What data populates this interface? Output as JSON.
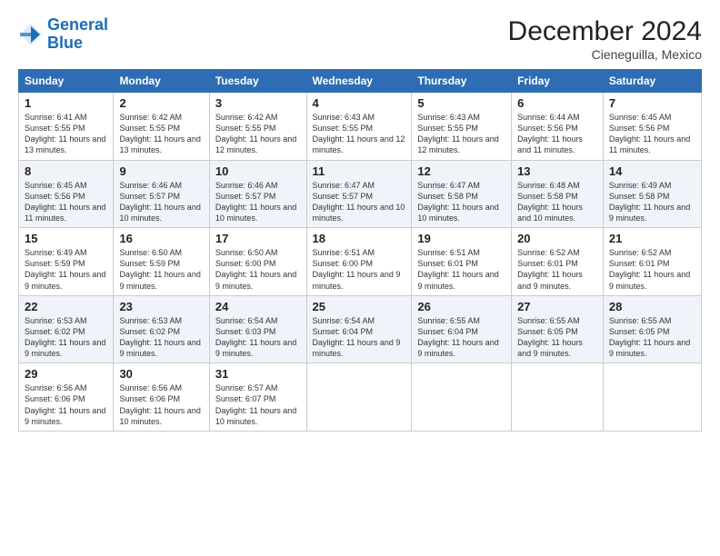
{
  "header": {
    "logo_line1": "General",
    "logo_line2": "Blue",
    "month": "December 2024",
    "location": "Cieneguilla, Mexico"
  },
  "weekdays": [
    "Sunday",
    "Monday",
    "Tuesday",
    "Wednesday",
    "Thursday",
    "Friday",
    "Saturday"
  ],
  "weeks": [
    [
      {
        "day": "1",
        "rise": "6:41 AM",
        "set": "5:55 PM",
        "hours": "11 hours and 13 minutes."
      },
      {
        "day": "2",
        "rise": "6:42 AM",
        "set": "5:55 PM",
        "hours": "11 hours and 13 minutes."
      },
      {
        "day": "3",
        "rise": "6:42 AM",
        "set": "5:55 PM",
        "hours": "11 hours and 12 minutes."
      },
      {
        "day": "4",
        "rise": "6:43 AM",
        "set": "5:55 PM",
        "hours": "11 hours and 12 minutes."
      },
      {
        "day": "5",
        "rise": "6:43 AM",
        "set": "5:55 PM",
        "hours": "11 hours and 12 minutes."
      },
      {
        "day": "6",
        "rise": "6:44 AM",
        "set": "5:56 PM",
        "hours": "11 hours and 11 minutes."
      },
      {
        "day": "7",
        "rise": "6:45 AM",
        "set": "5:56 PM",
        "hours": "11 hours and 11 minutes."
      }
    ],
    [
      {
        "day": "8",
        "rise": "6:45 AM",
        "set": "5:56 PM",
        "hours": "11 hours and 11 minutes."
      },
      {
        "day": "9",
        "rise": "6:46 AM",
        "set": "5:57 PM",
        "hours": "11 hours and 10 minutes."
      },
      {
        "day": "10",
        "rise": "6:46 AM",
        "set": "5:57 PM",
        "hours": "11 hours and 10 minutes."
      },
      {
        "day": "11",
        "rise": "6:47 AM",
        "set": "5:57 PM",
        "hours": "11 hours and 10 minutes."
      },
      {
        "day": "12",
        "rise": "6:47 AM",
        "set": "5:58 PM",
        "hours": "11 hours and 10 minutes."
      },
      {
        "day": "13",
        "rise": "6:48 AM",
        "set": "5:58 PM",
        "hours": "11 hours and 10 minutes."
      },
      {
        "day": "14",
        "rise": "6:49 AM",
        "set": "5:58 PM",
        "hours": "11 hours and 9 minutes."
      }
    ],
    [
      {
        "day": "15",
        "rise": "6:49 AM",
        "set": "5:59 PM",
        "hours": "11 hours and 9 minutes."
      },
      {
        "day": "16",
        "rise": "6:50 AM",
        "set": "5:59 PM",
        "hours": "11 hours and 9 minutes."
      },
      {
        "day": "17",
        "rise": "6:50 AM",
        "set": "6:00 PM",
        "hours": "11 hours and 9 minutes."
      },
      {
        "day": "18",
        "rise": "6:51 AM",
        "set": "6:00 PM",
        "hours": "11 hours and 9 minutes."
      },
      {
        "day": "19",
        "rise": "6:51 AM",
        "set": "6:01 PM",
        "hours": "11 hours and 9 minutes."
      },
      {
        "day": "20",
        "rise": "6:52 AM",
        "set": "6:01 PM",
        "hours": "11 hours and 9 minutes."
      },
      {
        "day": "21",
        "rise": "6:52 AM",
        "set": "6:01 PM",
        "hours": "11 hours and 9 minutes."
      }
    ],
    [
      {
        "day": "22",
        "rise": "6:53 AM",
        "set": "6:02 PM",
        "hours": "11 hours and 9 minutes."
      },
      {
        "day": "23",
        "rise": "6:53 AM",
        "set": "6:02 PM",
        "hours": "11 hours and 9 minutes."
      },
      {
        "day": "24",
        "rise": "6:54 AM",
        "set": "6:03 PM",
        "hours": "11 hours and 9 minutes."
      },
      {
        "day": "25",
        "rise": "6:54 AM",
        "set": "6:04 PM",
        "hours": "11 hours and 9 minutes."
      },
      {
        "day": "26",
        "rise": "6:55 AM",
        "set": "6:04 PM",
        "hours": "11 hours and 9 minutes."
      },
      {
        "day": "27",
        "rise": "6:55 AM",
        "set": "6:05 PM",
        "hours": "11 hours and 9 minutes."
      },
      {
        "day": "28",
        "rise": "6:55 AM",
        "set": "6:05 PM",
        "hours": "11 hours and 9 minutes."
      }
    ],
    [
      {
        "day": "29",
        "rise": "6:56 AM",
        "set": "6:06 PM",
        "hours": "11 hours and 9 minutes."
      },
      {
        "day": "30",
        "rise": "6:56 AM",
        "set": "6:06 PM",
        "hours": "11 hours and 10 minutes."
      },
      {
        "day": "31",
        "rise": "6:57 AM",
        "set": "6:07 PM",
        "hours": "11 hours and 10 minutes."
      },
      null,
      null,
      null,
      null
    ]
  ]
}
